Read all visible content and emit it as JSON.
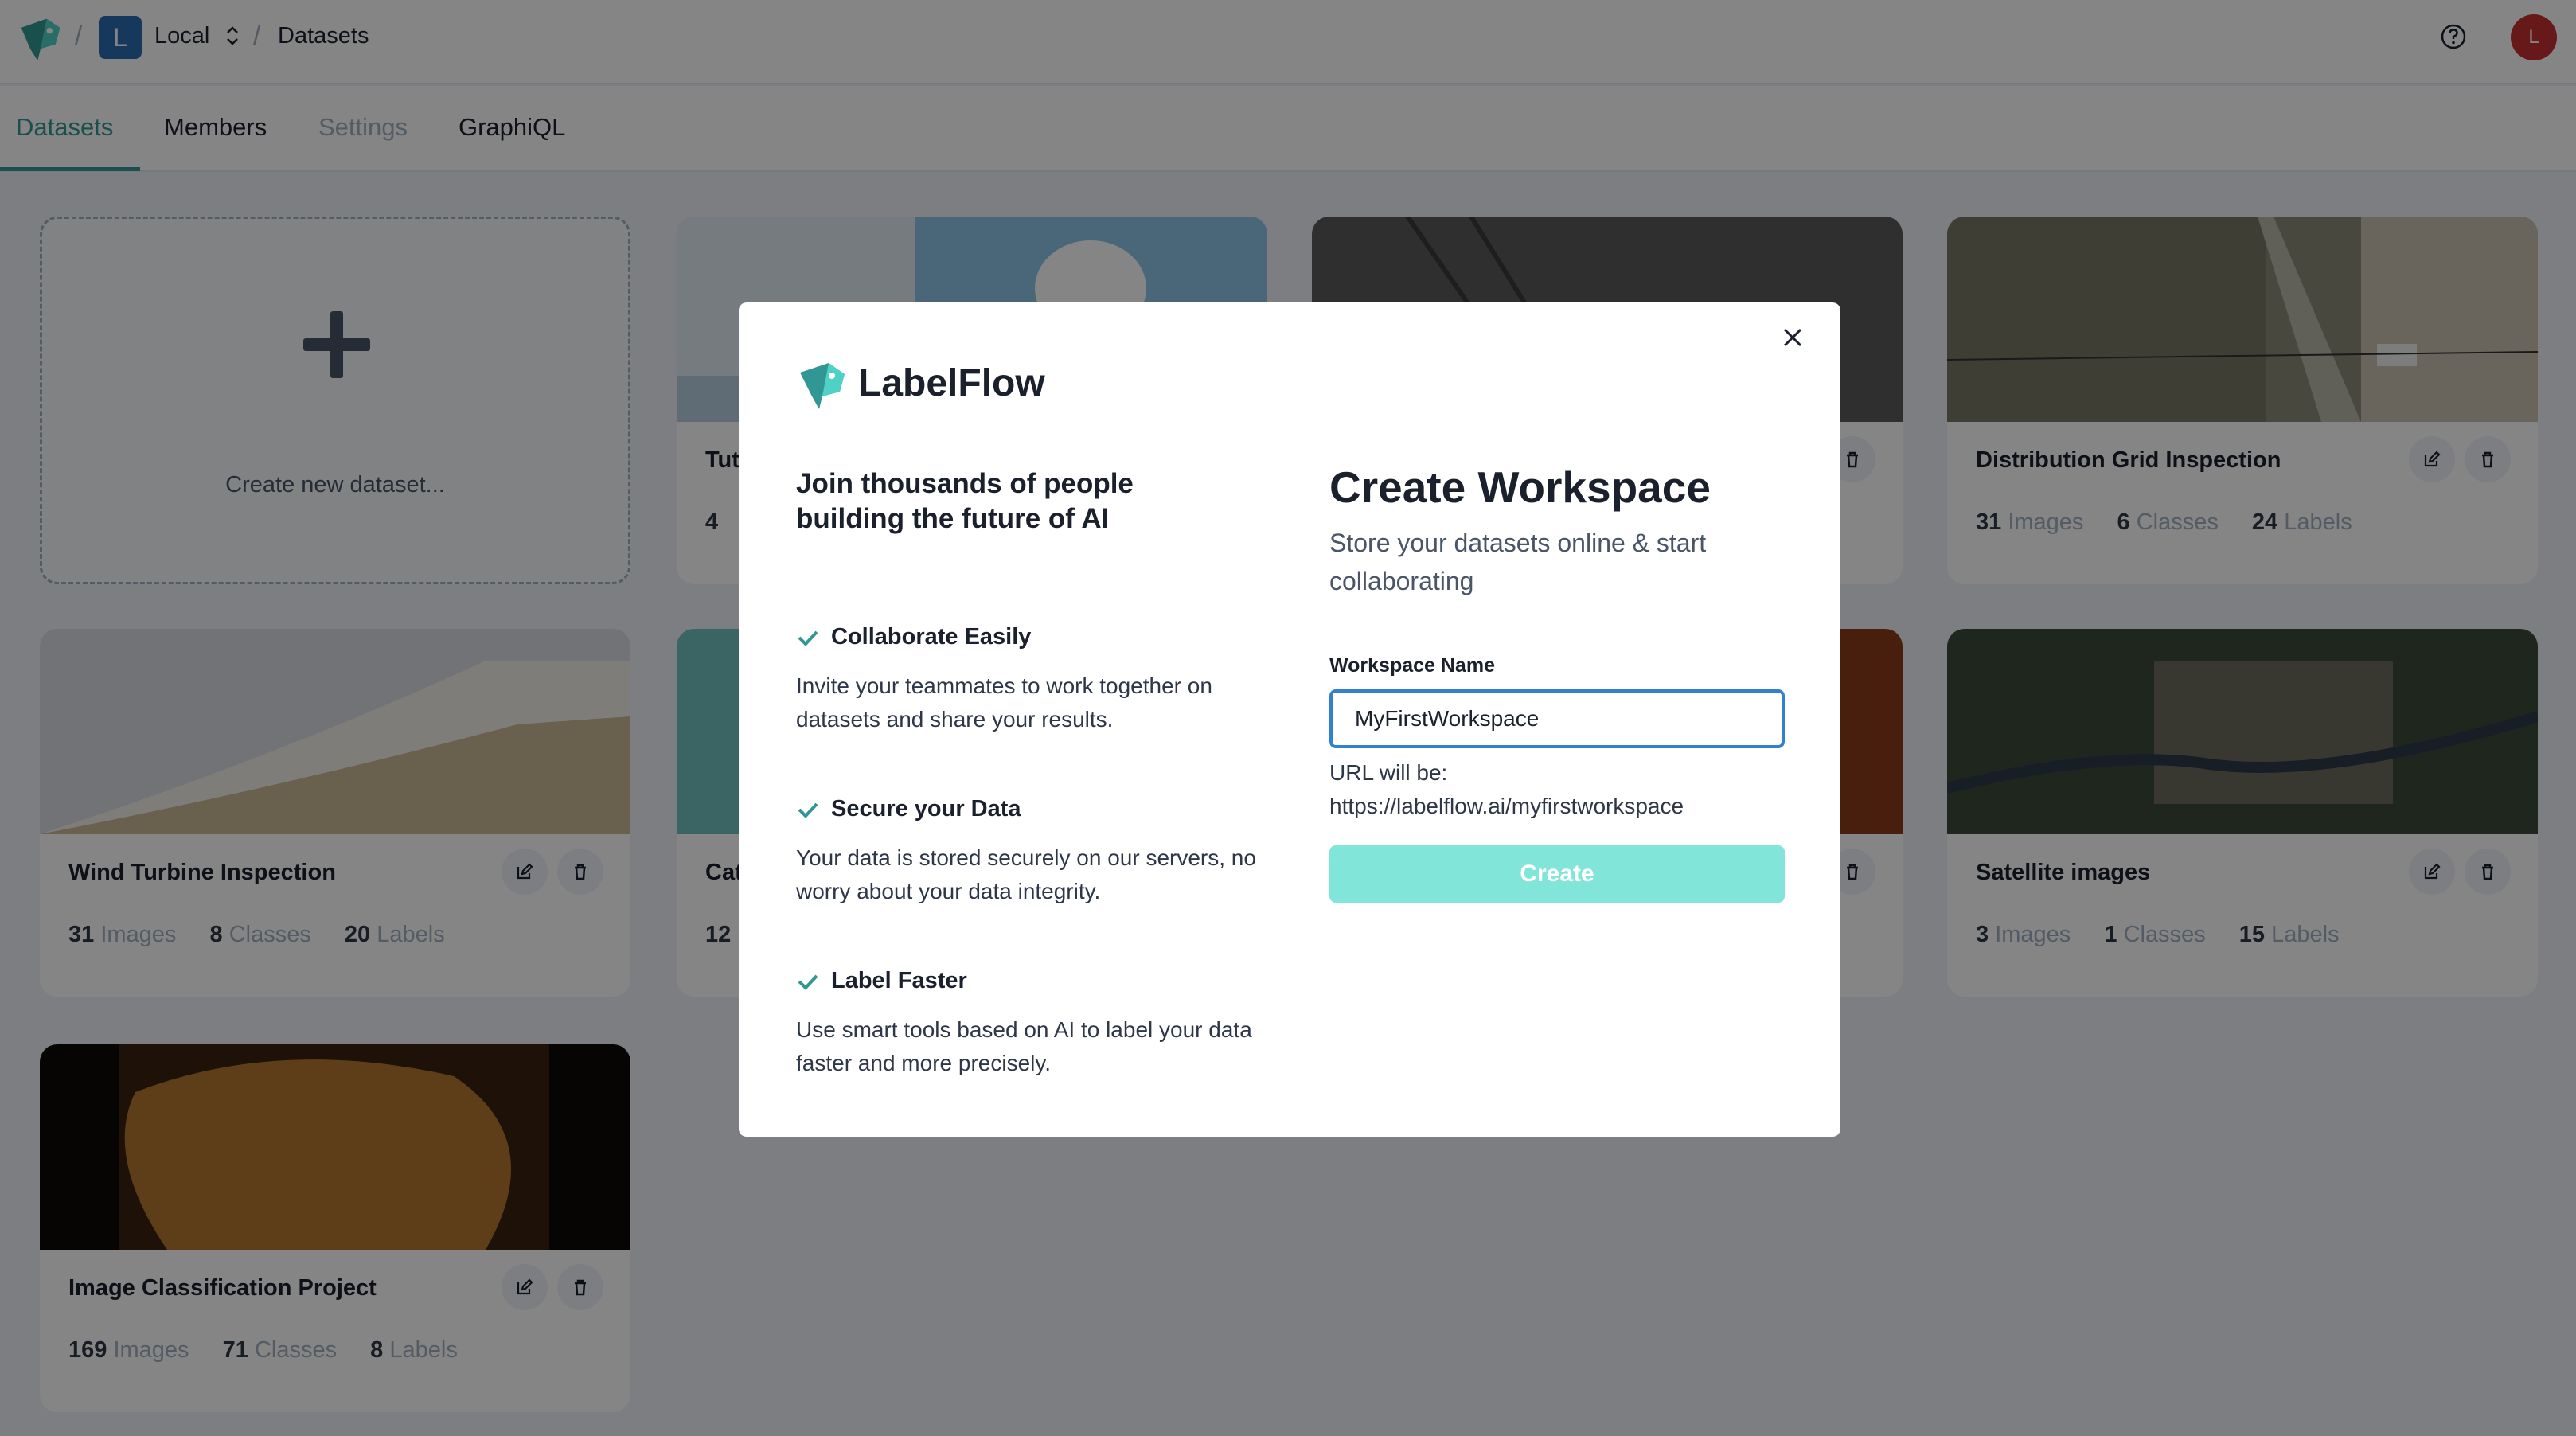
{
  "header": {
    "workspace_initial": "L",
    "workspace_name": "Local",
    "separator": "/",
    "page": "Datasets",
    "user_initial": "L"
  },
  "tabs": [
    {
      "label": "Datasets",
      "state": "active"
    },
    {
      "label": "Members",
      "state": "normal"
    },
    {
      "label": "Settings",
      "state": "disabled"
    },
    {
      "label": "GraphiQL",
      "state": "normal"
    }
  ],
  "new_dataset_label": "Create new dataset...",
  "datasets": [
    {
      "title": "Distribution Grid Inspection",
      "images": "31",
      "classes": "6",
      "labels": "24"
    },
    {
      "title": "Wind Turbine Inspection",
      "images": "31",
      "classes": "8",
      "labels": "20"
    },
    {
      "title": "Satellite images",
      "images": "3",
      "classes": "1",
      "labels": "15"
    },
    {
      "title": "Image Classification Project",
      "images": "169",
      "classes": "71",
      "labels": "8"
    }
  ],
  "partial_cards": [
    {
      "title_fragment": "Tut",
      "stat_fragment": "4"
    },
    {
      "title_fragment": "Cat",
      "stat_fragment": "12"
    }
  ],
  "stat_labels": {
    "images": "Images",
    "classes": "Classes",
    "labels": "Labels"
  },
  "modal": {
    "brand": "LabelFlow",
    "tagline": "Join thousands of people building the future of AI",
    "features": [
      {
        "title": "Collaborate Easily",
        "description": "Invite your teammates to work together on datasets and share your results."
      },
      {
        "title": "Secure your Data",
        "description": "Your data is stored securely on our servers, no worry about your data integrity."
      },
      {
        "title": "Label Faster",
        "description": "Use smart tools based on AI to label your data faster and more precisely."
      }
    ],
    "title": "Create Workspace",
    "subtitle": "Store your datasets online & start collaborating",
    "field_label": "Workspace Name",
    "field_value": "MyFirstWorkspace",
    "url_prefix": "URL will be:",
    "url_value": "https://labelflow.ai/myfirstworkspace",
    "submit_label": "Create"
  },
  "colors": {
    "accent": "#319795",
    "button": "#81e6d9",
    "focus": "#3182ce",
    "avatar": "#c53030"
  }
}
